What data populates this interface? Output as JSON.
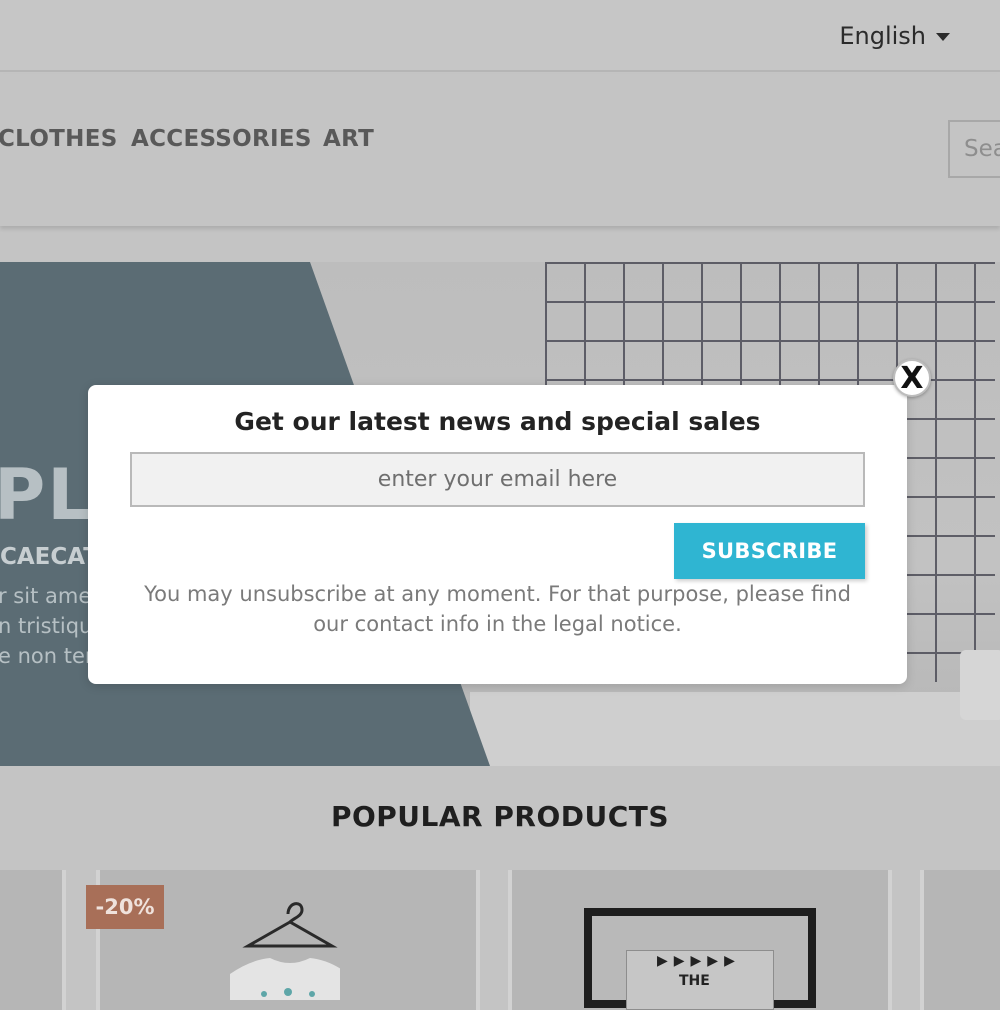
{
  "topbar": {
    "language": "English",
    "language_icon": "caret-down-icon"
  },
  "nav": {
    "items": [
      "CLOTHES",
      "ACCESSORIES",
      "ART"
    ],
    "search_placeholder": "Sea"
  },
  "hero": {
    "big_text": "PLE",
    "sub_text": "CAECAT",
    "lines": [
      "r sit amet",
      "n tristiqu",
      "e non tem"
    ]
  },
  "popular": {
    "title": "POPULAR PRODUCTS",
    "discount_badge": "-20%",
    "poster_text": "THE"
  },
  "modal": {
    "title": "Get our latest news and special sales",
    "email_placeholder": "enter your email here",
    "subscribe_label": "SUBSCRIBE",
    "notice": "You may unsubscribe at any moment. For that purpose, please find our contact info in the legal notice.",
    "close_label": "X"
  },
  "colors": {
    "accent": "#2fb5d2",
    "discount": "#e07b55",
    "overlay": "#c4c4c4"
  }
}
